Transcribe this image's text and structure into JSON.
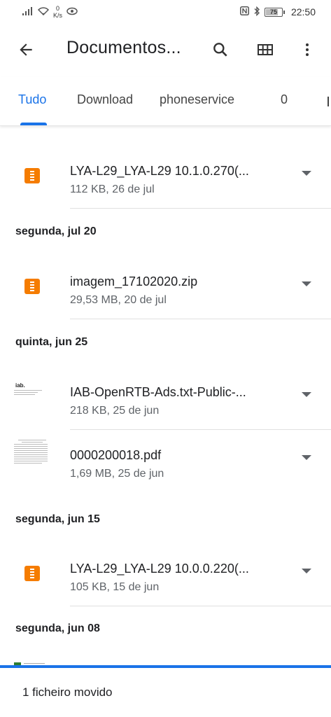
{
  "status_bar": {
    "net_speed_value": "0",
    "net_speed_unit": "K/s",
    "battery": "75",
    "time": "22:50"
  },
  "app_bar": {
    "title": "Documentos..."
  },
  "tabs": [
    {
      "label": "Tudo",
      "active": true
    },
    {
      "label": "Download",
      "active": false
    },
    {
      "label": "phoneservice",
      "active": false
    },
    {
      "label": "0",
      "active": false
    }
  ],
  "sections": {
    "jul20": "segunda, jul 20",
    "jun25": "quinta, jun 25",
    "jun15": "segunda, jun 15",
    "jun08": "segunda, jun 08"
  },
  "files": [
    {
      "name": "LYA-L29_LYA-L29 10.1.0.270(...",
      "meta": "112 KB, 26 de jul",
      "icon": "zip-icon"
    },
    {
      "name": "imagem_17102020.zip",
      "meta": "29,53 MB, 20 de jul",
      "icon": "zip-icon"
    },
    {
      "name": "IAB-OpenRTB-Ads.txt-Public-...",
      "meta": "218 KB, 25 de jun",
      "icon": "document-thumbnail"
    },
    {
      "name": "0000200018.pdf",
      "meta": "1,69 MB, 25 de jun",
      "icon": "pdf-thumbnail"
    },
    {
      "name": "LYA-L29_LYA-L29 10.0.0.220(...",
      "meta": "105 KB, 15 de jun",
      "icon": "zip-icon"
    }
  ],
  "snackbar": {
    "message": "1 ficheiro movido"
  },
  "colors": {
    "accent": "#1a73e8",
    "zip_icon": "#f57c00"
  }
}
